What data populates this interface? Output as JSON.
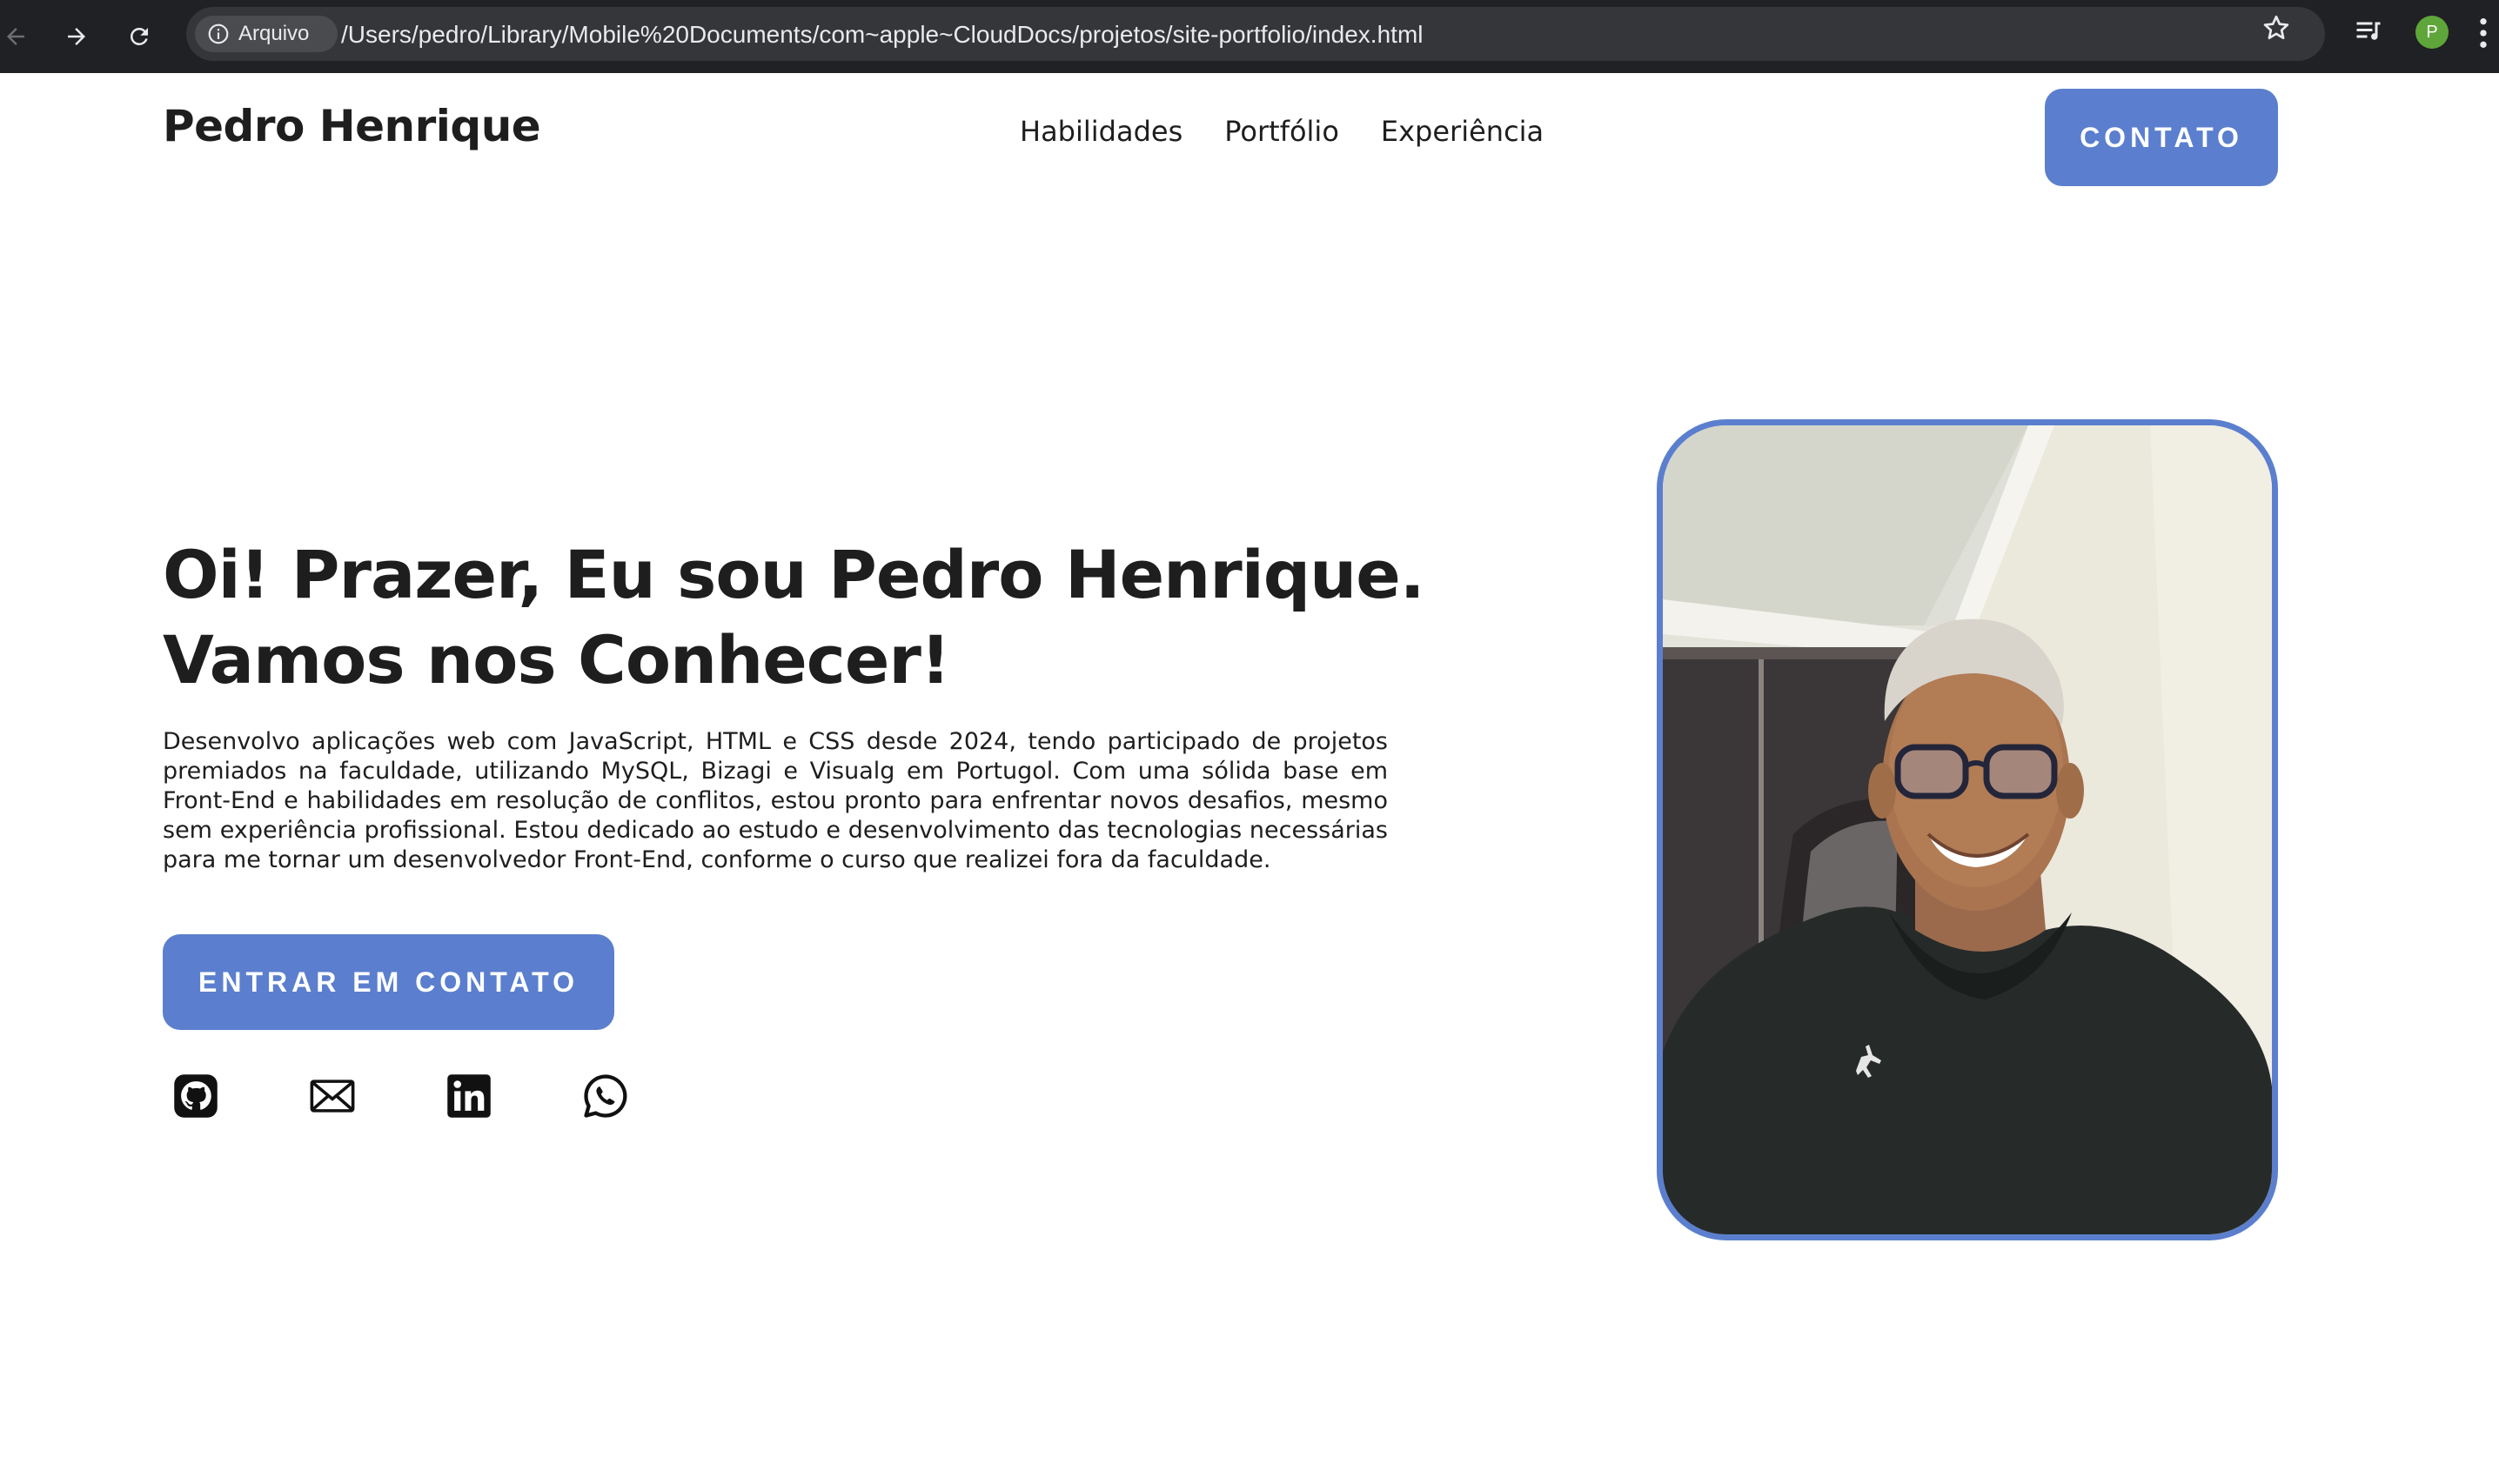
{
  "browser": {
    "site_info_label": "Arquivo",
    "url": "/Users/pedro/Library/Mobile%20Documents/com~apple~CloudDocs/projetos/site-portfolio/index.html",
    "profile_initial": "P"
  },
  "header": {
    "logo": "Pedro Henrique",
    "nav": [
      "Habilidades",
      "Portfólio",
      "Experiência"
    ],
    "contact_button": "CONTATO"
  },
  "hero": {
    "title_line1": "Oi! Prazer, Eu sou Pedro Henrique.",
    "title_line2": "Vamos nos Conhecer!",
    "description": "Desenvolvo aplicações web com JavaScript, HTML e CSS desde 2024, tendo participado de projetos premiados na faculdade, utilizando MySQL, Bizagi e Visualg em Portugol. Com uma sólida base em Front-End e habilidades em resolução de conflitos, estou pronto para enfrentar novos desafios, mesmo sem experiência profissional. Estou dedicado ao estudo e desenvolvimento das tecnologias necessárias para me tornar um desenvolvedor Front-End, conforme o curso que realizei fora da faculdade.",
    "cta_button": "ENTRAR EM CONTATO",
    "social_icons": [
      "github-icon",
      "mail-icon",
      "linkedin-icon",
      "whatsapp-icon"
    ]
  },
  "colors": {
    "accent": "#5b7fce",
    "text": "#1e1e1e",
    "chrome_bg": "#202124",
    "omnibox_bg": "#35363a"
  }
}
